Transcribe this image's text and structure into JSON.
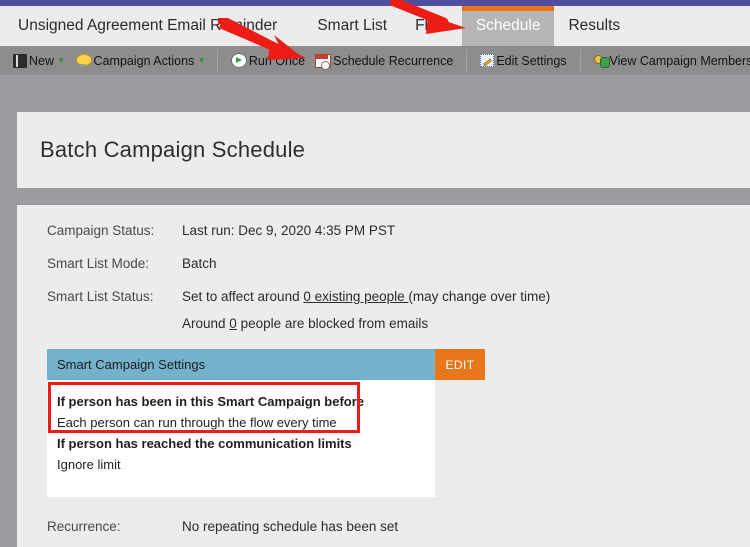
{
  "tabs": [
    {
      "label": "Unsigned Agreement Email Reminder",
      "active": false,
      "name": "campaign-name-tab"
    },
    {
      "label": "Smart List",
      "active": false,
      "name": "tab-smart-list"
    },
    {
      "label": "Flow",
      "active": false,
      "name": "tab-flow"
    },
    {
      "label": "Schedule",
      "active": true,
      "name": "tab-schedule"
    },
    {
      "label": "Results",
      "active": false,
      "name": "tab-results"
    }
  ],
  "toolbar": {
    "new_label": "New",
    "new_icon": "document-icon",
    "campaign_actions_label": "Campaign Actions",
    "campaign_actions_icon": "lightbulb-icon",
    "run_once_label": "Run Once",
    "run_once_icon": "play-circle-icon",
    "schedule_recurrence_label": "Schedule Recurrence",
    "schedule_recurrence_icon": "calendar-clock-icon",
    "edit_settings_label": "Edit Settings",
    "edit_settings_icon": "pencil-icon",
    "view_campaign_members_label": "View Campaign Members",
    "view_campaign_members_icon": "people-icon",
    "dropdown_caret": "▾"
  },
  "page": {
    "title": "Batch Campaign Schedule"
  },
  "info": {
    "campaign_status_label": "Campaign Status:",
    "campaign_status_value": "Last run: Dec 9, 2020 4:35 PM PST",
    "smart_list_mode_label": "Smart List Mode:",
    "smart_list_mode_value": "Batch",
    "smart_list_status_label": "Smart List Status:",
    "smart_list_status_prefix": "Set to affect around ",
    "smart_list_status_link": "0 existing people ",
    "smart_list_status_suffix": "(may change over time)",
    "blocked_prefix": "Around ",
    "blocked_link": "0",
    "blocked_suffix": " people are blocked from emails",
    "recurrence_label": "Recurrence:",
    "recurrence_value": "No repeating schedule has been set"
  },
  "smart_campaign_settings": {
    "header": "Smart Campaign Settings",
    "edit_label": "EDIT",
    "rows": [
      {
        "title": "If person has been in this Smart Campaign before",
        "value": "Each person can run through the flow every time"
      },
      {
        "title": "If person has reached the communication limits",
        "value": "Ignore limit"
      }
    ]
  },
  "annotations": {
    "arrow_color": "#ee1c16",
    "highlight_box_color": "#ee1c16",
    "arrow_1_target": "Schedule Recurrence",
    "arrow_2_target": "Schedule"
  },
  "colors": {
    "top_strip": "#4e4e9e",
    "tab_active_bg": "#b6b6b6",
    "tab_active_accent": "#e8730f",
    "toolbar_bg": "#8d8d8d",
    "page_bg": "#9a9a9f",
    "panel_bg": "#ececed",
    "settings_header": "#74b2cc",
    "edit_button": "#e8761a"
  }
}
